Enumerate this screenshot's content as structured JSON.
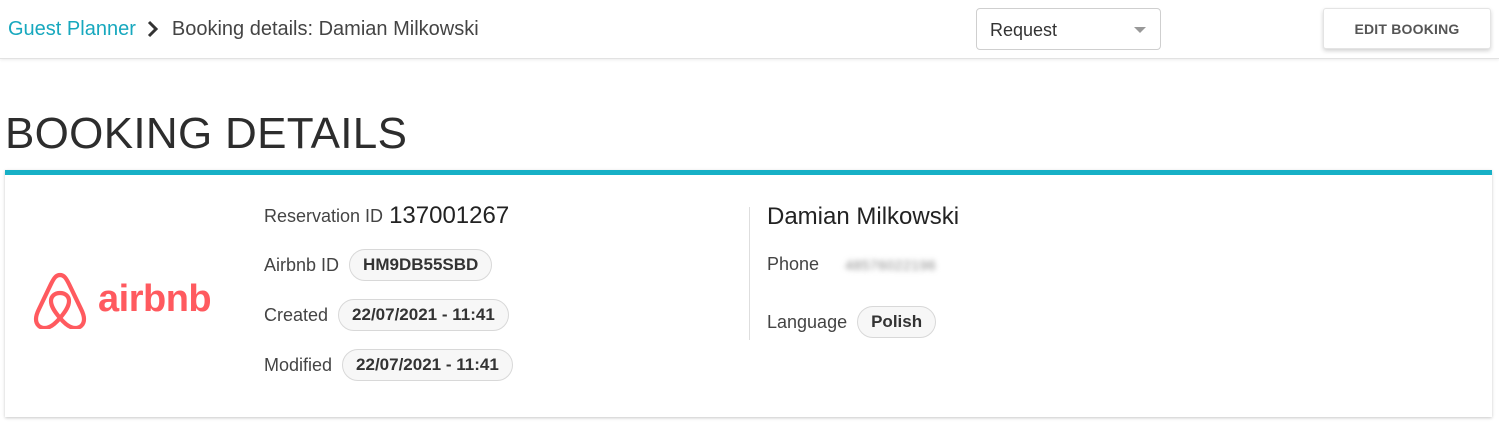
{
  "header": {
    "breadcrumb_root": "Guest Planner",
    "breadcrumb_current": "Booking details: Damian Milkowski",
    "status_select_value": "Request",
    "edit_button_label": "EDIT BOOKING"
  },
  "page": {
    "title": "BOOKING DETAILS"
  },
  "booking": {
    "channel_logo_text": "airbnb",
    "reservation_id_label": "Reservation ID",
    "reservation_id": "137001267",
    "airbnb_id_label": "Airbnb ID",
    "airbnb_id": "HM9DB55SBD",
    "created_label": "Created",
    "created": "22/07/2021 - 11:41",
    "modified_label": "Modified",
    "modified": "22/07/2021 - 11:41"
  },
  "guest": {
    "name": "Damian Milkowski",
    "phone_label": "Phone",
    "phone_value": "48576022196",
    "language_label": "Language",
    "language": "Polish"
  },
  "colors": {
    "accent": "#17a8be",
    "card_border": "#17b0c6",
    "airbnb": "#ff5a5f"
  },
  "icons": {
    "breadcrumb_separator": "chevron-right-icon",
    "select_caret": "caret-down-icon",
    "logo": "airbnb-logo"
  }
}
